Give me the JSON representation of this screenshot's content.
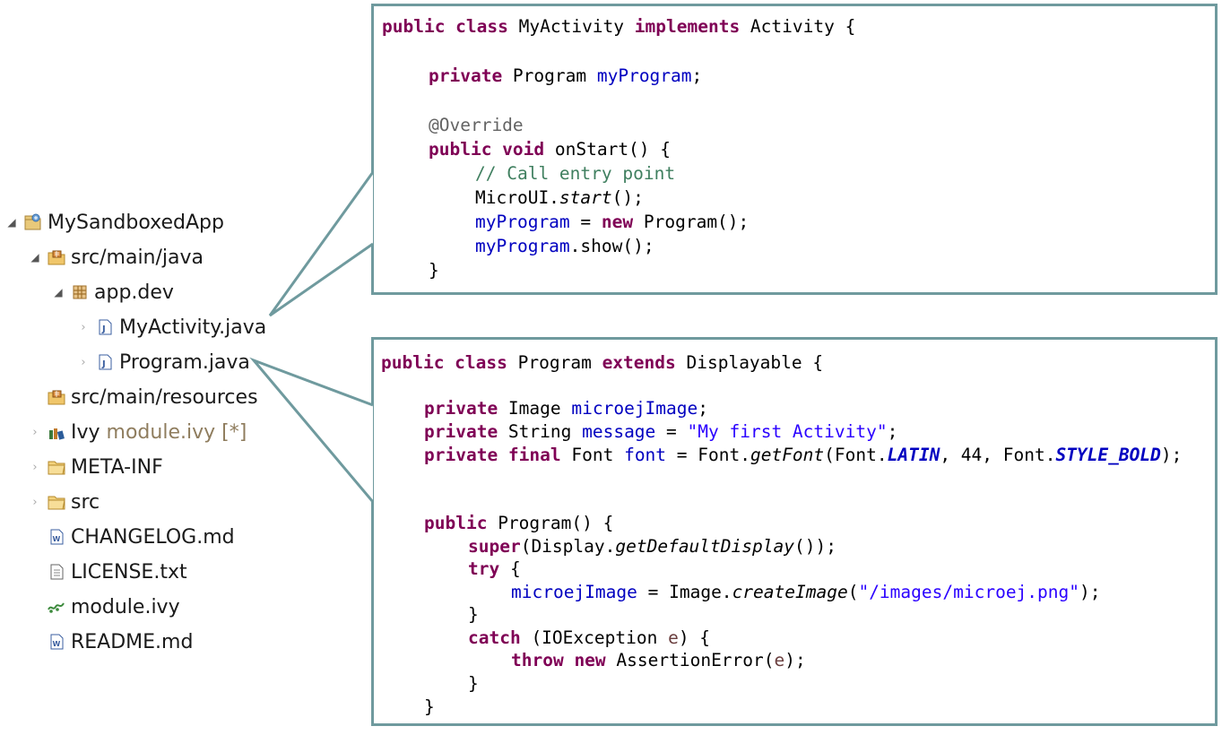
{
  "tree": {
    "items": [
      {
        "label": "MySandboxedApp",
        "icon": "project-icon",
        "twisty": "expanded"
      },
      {
        "label": "src/main/java",
        "icon": "source-folder-icon",
        "twisty": "expanded"
      },
      {
        "label": "app.dev",
        "icon": "package-icon",
        "twisty": "expanded"
      },
      {
        "label": "MyActivity.java",
        "icon": "java-file-icon",
        "twisty": "collapsed"
      },
      {
        "label": "Program.java",
        "icon": "java-file-icon",
        "twisty": "collapsed"
      },
      {
        "label": "src/main/resources",
        "icon": "source-folder-icon",
        "twisty": "none"
      },
      {
        "label": "Ivy",
        "suffix": "module.ivy [*]",
        "icon": "ivy-library-icon",
        "twisty": "collapsed"
      },
      {
        "label": "META-INF",
        "icon": "folder-icon",
        "twisty": "collapsed"
      },
      {
        "label": "src",
        "icon": "folder-icon",
        "twisty": "collapsed"
      },
      {
        "label": "CHANGELOG.md",
        "icon": "markdown-file-icon",
        "twisty": "none"
      },
      {
        "label": "LICENSE.txt",
        "icon": "text-file-icon",
        "twisty": "none"
      },
      {
        "label": "module.ivy",
        "icon": "ivy-file-icon",
        "twisty": "none"
      },
      {
        "label": "README.md",
        "icon": "markdown-file-icon",
        "twisty": "none"
      }
    ]
  },
  "code_myactivity": {
    "l1": {
      "a": "public class",
      "b": " MyActivity ",
      "c": "implements",
      "d": " Activity {"
    },
    "l2": {
      "a": "private",
      "b": " Program ",
      "c": "myProgram",
      "d": ";"
    },
    "l3": {
      "a": "@Override"
    },
    "l4": {
      "a": "public void",
      "b": " onStart() {"
    },
    "l5": {
      "a": "// Call entry point"
    },
    "l6": {
      "a": "MicroUI.",
      "b": "start",
      "c": "();"
    },
    "l7": {
      "a": "myProgram",
      "b": " = ",
      "c": "new",
      "d": " Program();"
    },
    "l8": {
      "a": "myProgram",
      "b": ".show();"
    },
    "l9": {
      "a": "}"
    }
  },
  "code_program": {
    "l1": {
      "a": "public class",
      "b": " Program ",
      "c": "extends",
      "d": " Displayable {"
    },
    "l2": {
      "a": "private",
      "b": " Image ",
      "c": "microejImage",
      "d": ";"
    },
    "l3": {
      "a": "private",
      "b": " String ",
      "c": "message",
      "d": " = ",
      "e": "\"My first Activity\"",
      "f": ";"
    },
    "l4": {
      "a": "private final",
      "b": " Font ",
      "c": "font",
      "d": " = Font.",
      "e": "getFont",
      "f": "(Font.",
      "g": "LATIN",
      "h": ", 44, Font.",
      "i": "STYLE_BOLD",
      "j": ");"
    },
    "l5": {
      "a": "public",
      "b": " Program() {"
    },
    "l6": {
      "a": "super",
      "b": "(Display.",
      "c": "getDefaultDisplay",
      "d": "());"
    },
    "l7": {
      "a": "try",
      "b": " {"
    },
    "l8": {
      "a": "microejImage",
      "b": " = Image.",
      "c": "createImage",
      "d": "(",
      "e": "\"/images/microej.png\"",
      "f": ");"
    },
    "l9": {
      "a": "}"
    },
    "l10": {
      "a": "catch",
      "b": " (IOException ",
      "c": "e",
      "d": ") {"
    },
    "l11": {
      "a": "throw new",
      "b": " AssertionError(",
      "c": "e",
      "d": ");"
    },
    "l12": {
      "a": "}"
    },
    "l13": {
      "a": "}"
    }
  },
  "colors": {
    "keyword": "#7f0055",
    "field": "#0000c0",
    "comment": "#3f7f5f",
    "annotation": "#646464",
    "string": "#2a00ff",
    "callout_border": "#6f9a9e"
  }
}
